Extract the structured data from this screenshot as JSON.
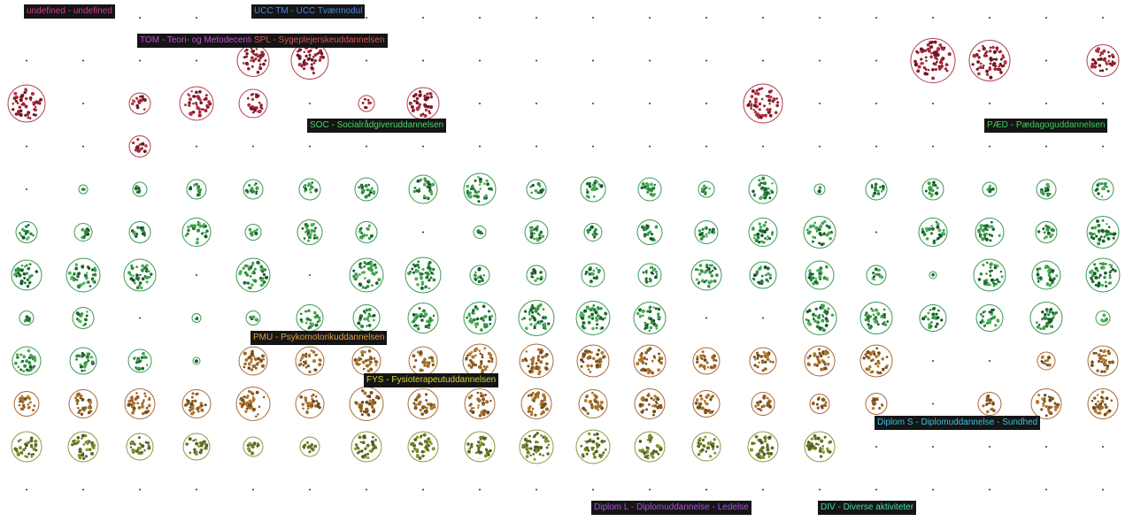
{
  "colors": {
    "background": "#ffffff",
    "red_group": "#b03040",
    "green_group": "#2e9a4a",
    "orange_group": "#c07a2a",
    "olive_group": "#7a8a2a",
    "grid_dot": "#333333"
  },
  "labels": [
    {
      "code": "undefined",
      "sep": "-",
      "name": "undefined",
      "color": "#d23c8c"
    },
    {
      "code": "UCC TM",
      "sep": "-",
      "name": "UCC Tværmodul",
      "color": "#4a86e8"
    },
    {
      "code": "TOM",
      "sep": "-",
      "name": "Teori- og Metodecenter",
      "color": "#c84cd8"
    },
    {
      "code": "SPL",
      "sep": "-",
      "name": "Sygeplejerskeuddannelsen",
      "color": "#e05050"
    },
    {
      "code": "SOC",
      "sep": "-",
      "name": "Socialrådgiveruddannelsen",
      "color": "#4cd66e"
    },
    {
      "code": "PÆD",
      "sep": "-",
      "name": "Pædagoguddannelsen",
      "color": "#3fd05a"
    },
    {
      "code": "PMU",
      "sep": "-",
      "name": "Psykomotorikuddannelsen",
      "color": "#e8a040"
    },
    {
      "code": "FYS",
      "sep": "-",
      "name": "Fysioterapeutuddannelsen",
      "color": "#d8d840"
    },
    {
      "code": "Diplom S",
      "sep": "-",
      "name": "Diplomuddannelse - Sundhed",
      "color": "#40c0e0"
    },
    {
      "code": "Diplom L",
      "sep": "-",
      "name": "Diplomuddannelse - Ledelse",
      "color": "#b050e0"
    },
    {
      "code": "DIV",
      "sep": "-",
      "name": "Diverse aktiviteter",
      "color": "#40e0a0"
    }
  ]
}
